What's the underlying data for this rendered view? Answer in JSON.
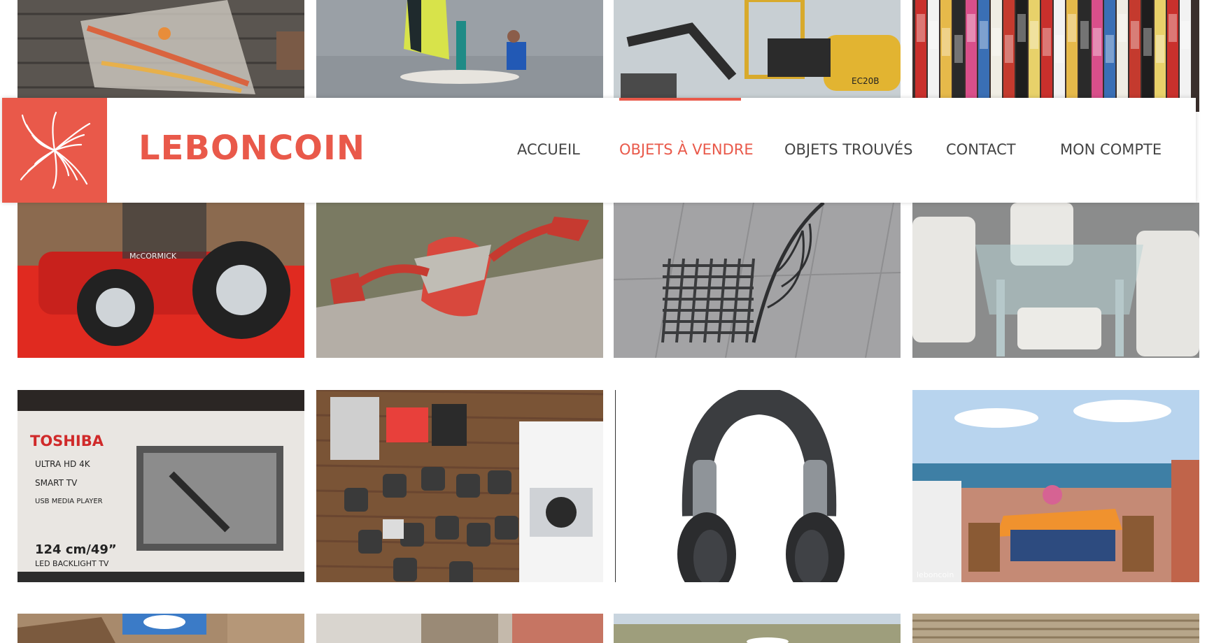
{
  "brand": {
    "name": "LEBONCOIN",
    "logo_icon": "sunburst-logo-icon"
  },
  "nav": {
    "items": [
      {
        "label": "ACCUEIL",
        "active": false
      },
      {
        "label": "OBJETS À VENDRE",
        "active": true
      },
      {
        "label": "OBJETS TROUVÉS",
        "active": false
      },
      {
        "label": "CONTACT",
        "active": false
      },
      {
        "label": "MON COMPTE",
        "active": false
      }
    ]
  },
  "gallery": {
    "rows": [
      [
        "windsurf-sail",
        "windsurf-lesson",
        "mini-excavator",
        "manga-books"
      ],
      [
        "toy-tractor",
        "red-garden-sculpture",
        "wrought-iron-chair",
        "glass-dining-table"
      ],
      [
        "toshiba-tv-box",
        "action-camera-kit",
        "headphones",
        "sea-view-terrace"
      ],
      [
        "stone-houses",
        "village-street",
        "beach-path",
        "wooden-fence"
      ]
    ],
    "captions": {
      "sea-view-terrace": "leboncoin"
    }
  },
  "colors": {
    "accent": "#e9594a",
    "nav_text": "#444444"
  }
}
